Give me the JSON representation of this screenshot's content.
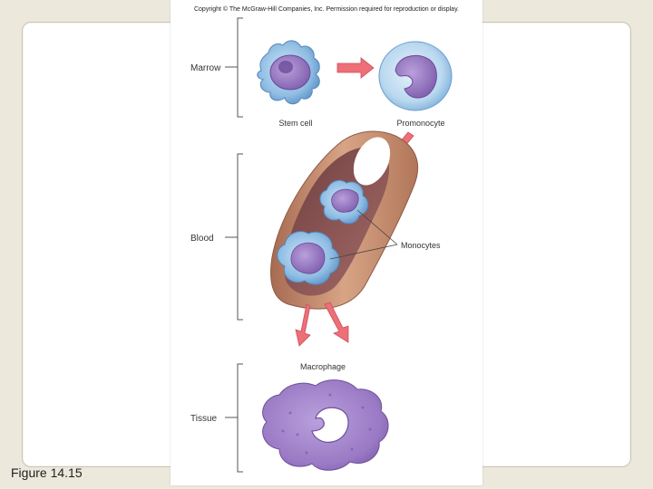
{
  "copyright": "Copyright © The McGraw-Hill Companies, Inc. Permission required for reproduction or display.",
  "stages": {
    "marrow": "Marrow",
    "blood": "Blood",
    "tissue": "Tissue"
  },
  "cells": {
    "stem_cell": "Stem cell",
    "promonocyte": "Promonocyte",
    "monocytes": "Monocytes",
    "macrophage": "Macrophage"
  },
  "caption": "Figure 14.15",
  "colors": {
    "background": "#ece9dc",
    "panel": "#ffffff",
    "arrow": "#ee6f78",
    "stem_cell_body": "#8fbde3",
    "nucleus": "#9676c0",
    "vessel": "#c99172",
    "vessel_lumen": "#8f5a59",
    "macrophage": "#9a7ac4"
  }
}
